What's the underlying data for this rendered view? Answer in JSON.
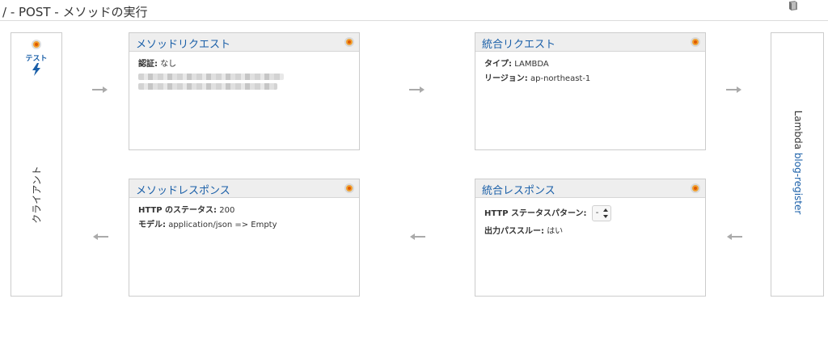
{
  "header": {
    "title": "/ - POST - メソッドの実行",
    "icon": "book-icon"
  },
  "client": {
    "test_label": "テスト",
    "label": "クライアント"
  },
  "method_request": {
    "title": "メソッドリクエスト",
    "auth_key": "認証:",
    "auth_value": "なし"
  },
  "integration_request": {
    "title": "統合リクエスト",
    "type_key": "タイプ:",
    "type_value": "LAMBDA",
    "region_key": "リージョン:",
    "region_value": "ap-northeast-1"
  },
  "method_response": {
    "title": "メソッドレスポンス",
    "status_key": "HTTP のステータス:",
    "status_value": "200",
    "model_key": "モデル:",
    "model_value": "application/json => Empty"
  },
  "integration_response": {
    "title": "統合レスポンス",
    "pattern_key": "HTTP ステータスパターン:",
    "pattern_value": "-",
    "passthrough_key": "出力パススルー:",
    "passthrough_value": "はい"
  },
  "lambda": {
    "prefix": "Lambda",
    "function": "blog-register"
  },
  "colors": {
    "link": "#1a5fa8",
    "status": "#f0a030",
    "arrow": "#aaaaaa"
  }
}
